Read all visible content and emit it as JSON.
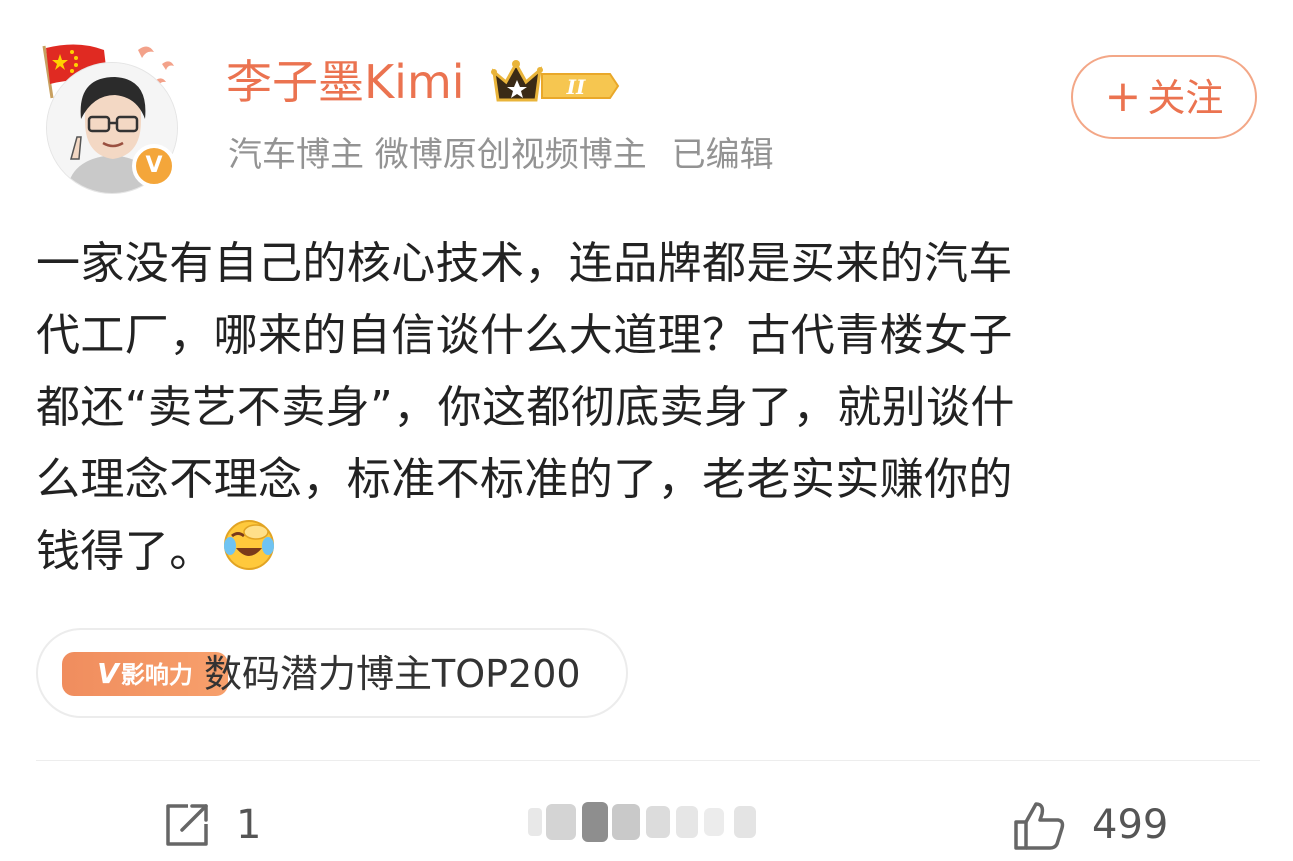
{
  "post": {
    "user": {
      "name": "李子墨Kimi",
      "level_badge": "II",
      "meta": [
        "汽车博主 微博原创视频博主",
        "已编辑"
      ],
      "verified_mark": "V"
    },
    "follow_button": {
      "plus": "+",
      "label": "关注"
    },
    "text_lines": [
      "一家没有自己的核心技术，连品牌都是买来的汽车",
      "代工厂，哪来的自信谈什么大道理？古代青楼女子",
      "都还“卖艺不卖身”，你这都彻底卖身了，就别谈什",
      "么理念不理念，标准不标准的了，老老实实赚你的",
      "钱得了。"
    ],
    "emoji": "laugh-cry-emoji",
    "tag": {
      "logo_v": "V",
      "logo_text": "影响力",
      "text": "数码潜力博主TOP200"
    },
    "actions": {
      "repost_count": "1",
      "like_count": "499"
    }
  },
  "colors": {
    "accent": "#eb7350",
    "meta_gray": "#939393",
    "badge_orange": "#f4a63a"
  },
  "icons": [
    "flag-icon",
    "crown-badge-icon",
    "verified-icon",
    "repost-icon",
    "like-icon"
  ]
}
